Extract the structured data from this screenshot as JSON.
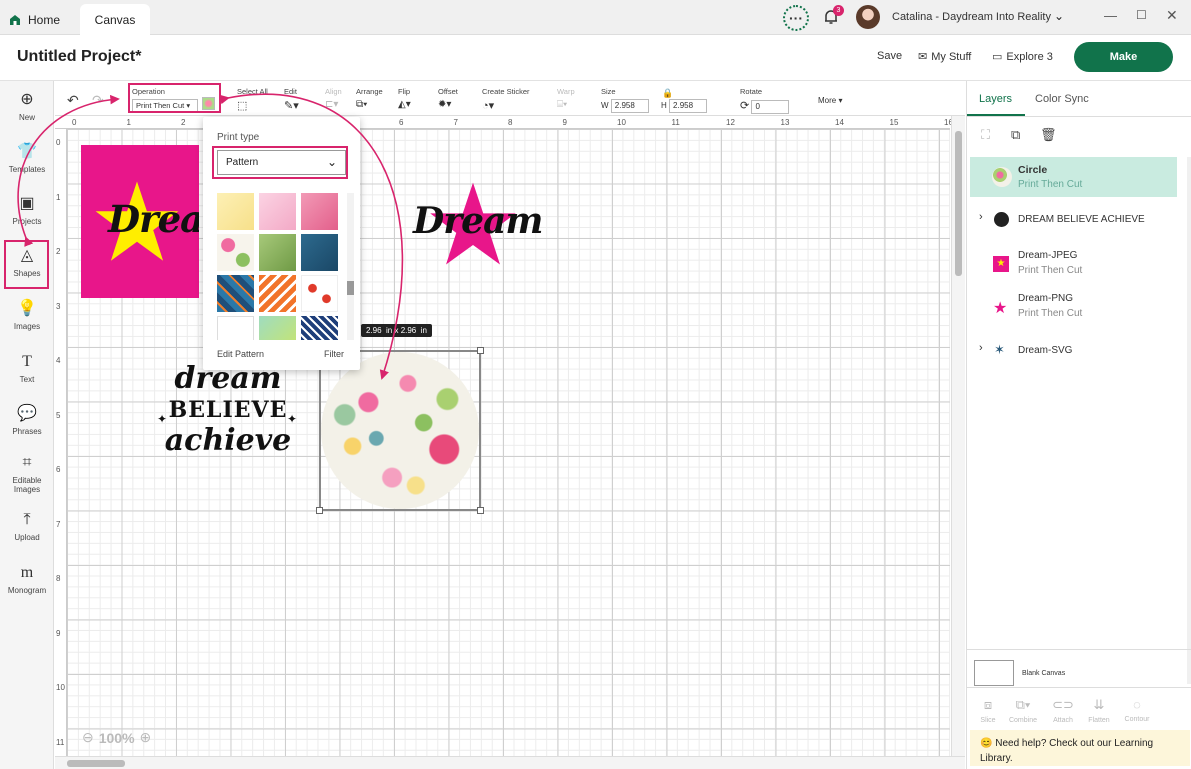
{
  "tabs": {
    "home": "Home",
    "canvas": "Canvas"
  },
  "user": {
    "notifications": "3",
    "name": "Catalina - Daydream Into Reality"
  },
  "header": {
    "project_title": "Untitled Project*",
    "save": "Save",
    "my_stuff": "My Stuff",
    "machine": "Explore 3",
    "make": "Make"
  },
  "toolbar": {
    "operation_label": "Operation",
    "operation_value": "Print Then Cut",
    "select_all": "Select All",
    "edit": "Edit",
    "align": "Align",
    "arrange": "Arrange",
    "flip": "Flip",
    "offset": "Offset",
    "create_sticker": "Create Sticker",
    "warp": "Warp",
    "size": "Size",
    "w_label": "W",
    "w_value": "2.958",
    "h_label": "H",
    "h_value": "2.958",
    "rotate": "Rotate",
    "rotate_value": "0",
    "more": "More"
  },
  "sidebar": [
    {
      "label": "New",
      "icon": "plus-circle-icon"
    },
    {
      "label": "Templates",
      "icon": "shirt-icon"
    },
    {
      "label": "Projects",
      "icon": "projects-icon"
    },
    {
      "label": "Shapes",
      "icon": "shapes-icon"
    },
    {
      "label": "Images",
      "icon": "lightbulb-icon"
    },
    {
      "label": "Text",
      "icon": "text-icon"
    },
    {
      "label": "Phrases",
      "icon": "speech-bubble-icon"
    },
    {
      "label": "Editable Images",
      "icon": "editable-image-icon"
    },
    {
      "label": "Upload",
      "icon": "upload-icon"
    },
    {
      "label": "Monogram",
      "icon": "monogram-icon"
    }
  ],
  "ruler": {
    "top": [
      "0",
      "1",
      "2",
      "3",
      "4",
      "5",
      "6",
      "7",
      "8",
      "9",
      "10",
      "11",
      "12",
      "13",
      "14",
      "15",
      "16"
    ],
    "left": [
      "0",
      "1",
      "2",
      "3",
      "4",
      "5",
      "6",
      "7",
      "8",
      "9",
      "10",
      "11"
    ]
  },
  "popup": {
    "print_type_label": "Print type",
    "print_type_value": "Pattern",
    "edit_pattern": "Edit Pattern",
    "filter": "Filter"
  },
  "canvas": {
    "size_tooltip": "2.96  in x 2.96  in",
    "zoom": "100%",
    "dream_text": "Dream",
    "phrase": [
      "dream",
      "BELIEVE",
      "achieve"
    ]
  },
  "layers_panel": {
    "tab_layers": "Layers",
    "tab_color_sync": "Color Sync",
    "layers": [
      {
        "name": "Circle",
        "sub": "Print Then Cut",
        "selected": true
      },
      {
        "name": "DREAM BELIEVE ACHIEVE",
        "sub": "",
        "group": true
      },
      {
        "name": "Dream-JPEG",
        "sub": "Print Then Cut"
      },
      {
        "name": "Dream-PNG",
        "sub": "Print Then Cut"
      },
      {
        "name": "Dream-SVG",
        "sub": "",
        "group": true
      }
    ],
    "blank_canvas": "Blank Canvas",
    "bottom_actions": [
      "Slice",
      "Combine",
      "Attach",
      "Flatten",
      "Contour"
    ],
    "help_text": "Need help? Check out our Learning Library."
  },
  "colors": {
    "brand_green": "#11734b",
    "highlight_pink": "#d8246c",
    "magenta": "#e8168a",
    "star_yellow": "#ffee00",
    "layer_selected": "#c9ebe0"
  }
}
